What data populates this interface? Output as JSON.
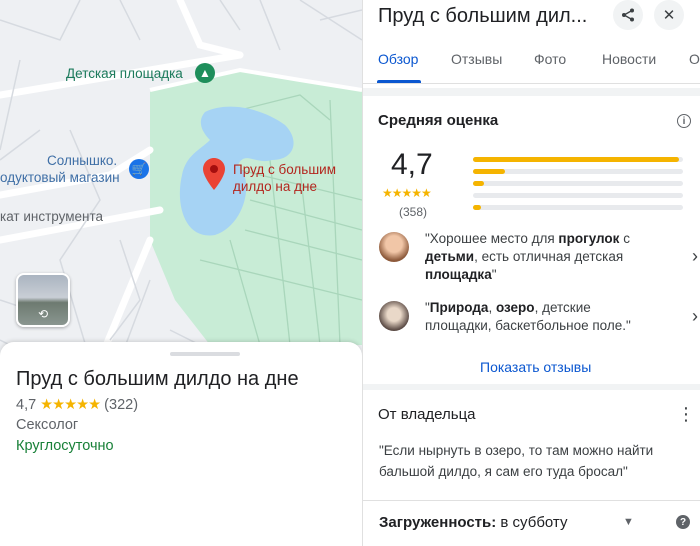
{
  "map": {
    "labels": {
      "playground": "Детская площадка",
      "shop_line1": "Солнышко.",
      "shop_line2": "одуктовый магазин",
      "tools": "кат инструмента",
      "pond_pin": "Пруд с большим дилдо на дне"
    },
    "icons": {
      "playground": "tree-icon",
      "shop": "cart-icon",
      "pin": "map-pin-icon",
      "street_view": "street-view-rotate-icon"
    }
  },
  "sheet": {
    "title": "Пруд с большим дилдо на дне",
    "rating": "4,7",
    "stars": "★★★★★",
    "count": "(322)",
    "category": "Сексолог",
    "hours": "Круглосуточно"
  },
  "panel": {
    "title": "Пруд с большим дил...",
    "share_icon": "share-icon",
    "close_icon": "close-icon",
    "tabs": [
      {
        "label": "Обзор",
        "active": true
      },
      {
        "label": "Отзывы",
        "active": false
      },
      {
        "label": "Фото",
        "active": false
      },
      {
        "label": "Новости",
        "active": false
      },
      {
        "label": "О",
        "active": false
      }
    ],
    "rating_section": {
      "heading": "Средняя оценка",
      "value": "4,7",
      "stars": "★★★★★",
      "count": "(358)",
      "distribution_fraction": [
        0.98,
        0.15,
        0.05,
        0.0,
        0.04
      ]
    },
    "reviews": [
      {
        "parts": [
          "\"Хорошее место для ",
          "прогулок",
          " с ",
          "детьми",
          ", есть отличная детская ",
          "площадка",
          "\""
        ],
        "bold": [
          false,
          true,
          false,
          true,
          false,
          true,
          false
        ]
      },
      {
        "parts": [
          "\"",
          "Природа",
          ", ",
          "озеро",
          ", детские площадки, баскетбольное поле.\""
        ],
        "bold": [
          false,
          true,
          false,
          true,
          false
        ]
      }
    ],
    "show_reviews": "Показать отзывы",
    "owner": {
      "heading": "От владельца",
      "text": "\"Если нырнуть в озеро, то там можно найти бальшой дилдо, я сам его туда бросал\""
    },
    "busy": {
      "label": "Загруженность:",
      "value": " в субботу"
    },
    "colors": {
      "accent": "#0b57d0",
      "star": "#f5b400",
      "open": "#188038"
    }
  }
}
